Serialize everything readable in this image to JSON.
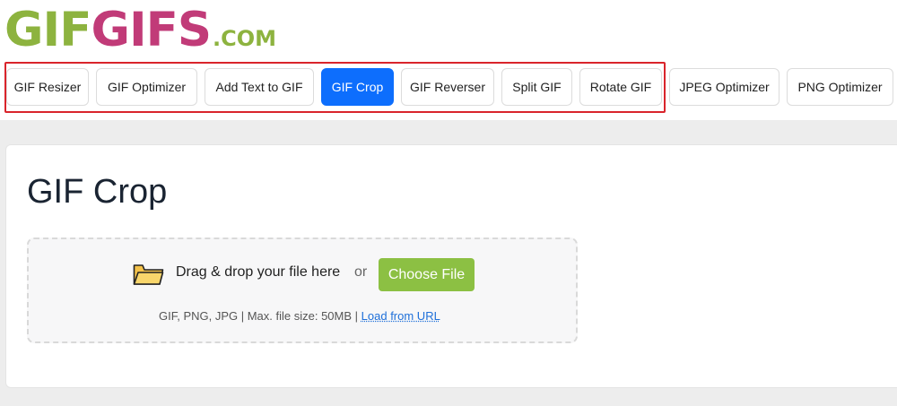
{
  "logo": {
    "part1": "GIF",
    "part2": "GIFS",
    "suffix": ".COM"
  },
  "nav": {
    "items": [
      {
        "label": "GIF Resizer",
        "active": false
      },
      {
        "label": "GIF Optimizer",
        "active": false
      },
      {
        "label": "Add Text to GIF",
        "active": false
      },
      {
        "label": "GIF Crop",
        "active": true
      },
      {
        "label": "GIF Reverser",
        "active": false
      },
      {
        "label": "Split GIF",
        "active": false
      },
      {
        "label": "Rotate GIF",
        "active": false
      },
      {
        "label": "JPEG Optimizer",
        "active": false
      },
      {
        "label": "PNG Optimizer",
        "active": false
      }
    ]
  },
  "page": {
    "title": "GIF Crop"
  },
  "upload": {
    "drag_text": "Drag & drop your file here",
    "or_text": "or",
    "choose_label": "Choose File",
    "info_text": "GIF, PNG, JPG | Max. file size: 50MB |",
    "url_link": "Load from URL",
    "folder_icon": "folder-icon"
  },
  "colors": {
    "accent": "#0d6efd",
    "choose_button": "#8cc043",
    "logo_green": "#8db33f",
    "logo_pink": "#c13b78",
    "highlight": "#d9242b"
  }
}
